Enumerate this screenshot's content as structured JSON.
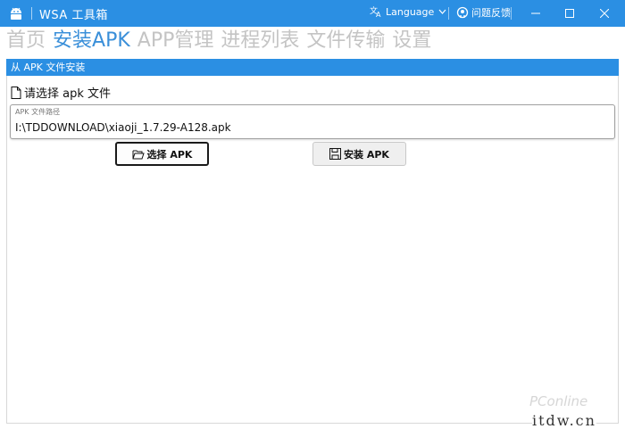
{
  "window": {
    "title": "WSA 工具箱",
    "language_label": "Language",
    "feedback_label": "问题反馈",
    "accent": "#2b8fe3",
    "icons": {
      "app": "android-icon",
      "language": "translate-icon",
      "feedback": "github-icon",
      "minimize": "minimize-icon",
      "maximize": "maximize-icon",
      "close": "close-icon"
    }
  },
  "tabs": [
    {
      "label": "首页",
      "active": false
    },
    {
      "label": "安装APK",
      "active": true
    },
    {
      "label": "APP管理",
      "active": false
    },
    {
      "label": "进程列表",
      "active": false
    },
    {
      "label": "文件传输",
      "active": false
    },
    {
      "label": "设置",
      "active": false
    }
  ],
  "install_panel": {
    "header": "从 APK 文件安装",
    "choose_label": "请选择 apk 文件",
    "path_caption": "APK 文件路径",
    "path_value": "I:\\TDDOWNLOAD\\xiaoji_1.7.29-A128.apk",
    "select_button": "选择 APK",
    "install_button": "安装 APK"
  },
  "watermark": {
    "brand": "PConline",
    "site": "itdw.cn"
  }
}
